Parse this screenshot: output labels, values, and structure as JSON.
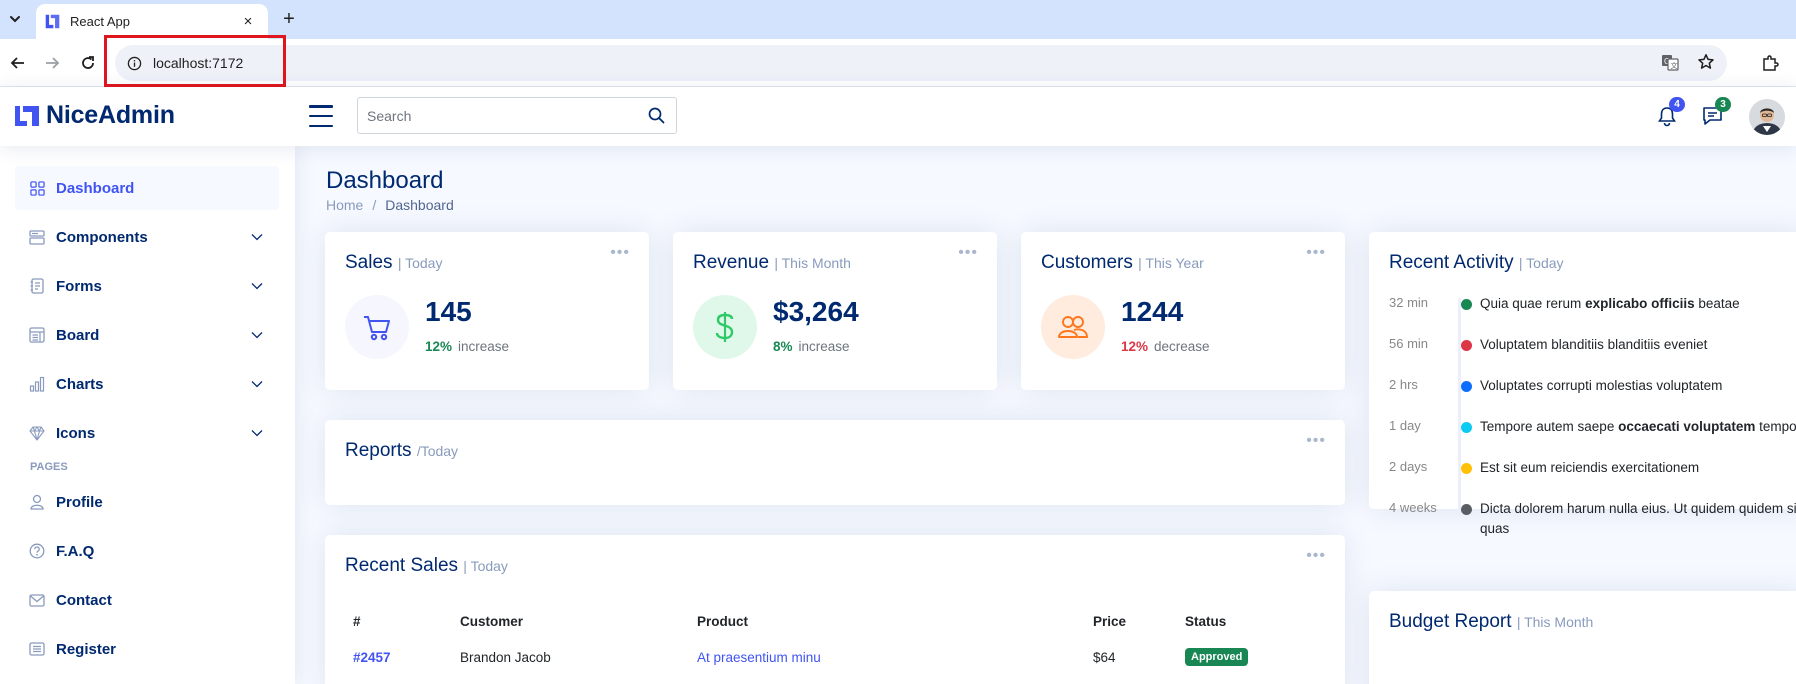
{
  "browser": {
    "tab_title": "React App",
    "url": "localhost:7172",
    "new_tab_symbol": "+",
    "close_symbol": "×"
  },
  "header": {
    "logo_text": "NiceAdmin",
    "search_placeholder": "Search",
    "notifications_count": "4",
    "messages_count": "3"
  },
  "sidebar": {
    "items": [
      {
        "label": "Dashboard",
        "icon": "grid-icon",
        "active": true,
        "has_chevron": false
      },
      {
        "label": "Components",
        "icon": "menu-button-icon",
        "has_chevron": true
      },
      {
        "label": "Forms",
        "icon": "journal-text-icon",
        "has_chevron": true
      },
      {
        "label": "Board",
        "icon": "layout-text-window-icon",
        "has_chevron": true
      },
      {
        "label": "Charts",
        "icon": "bar-chart-icon",
        "has_chevron": true
      },
      {
        "label": "Icons",
        "icon": "gem-icon",
        "has_chevron": true
      }
    ],
    "pages_heading": "Pages",
    "pages": [
      {
        "label": "Profile",
        "icon": "person-icon"
      },
      {
        "label": "F.A.Q",
        "icon": "question-circle-icon"
      },
      {
        "label": "Contact",
        "icon": "envelope-icon"
      },
      {
        "label": "Register",
        "icon": "card-list-icon"
      }
    ]
  },
  "page": {
    "title": "Dashboard",
    "breadcrumb": [
      "Home",
      "/",
      "Dashboard"
    ]
  },
  "cards": {
    "sales": {
      "title": "Sales",
      "period": "| Today",
      "value": "145",
      "pct": "12%",
      "word": "increase",
      "icon": "cart-icon"
    },
    "revenue": {
      "title": "Revenue",
      "period": "| This Month",
      "value": "$3,264",
      "pct": "8%",
      "word": "increase",
      "icon": "currency-dollar-icon"
    },
    "customers": {
      "title": "Customers",
      "period": "| This Year",
      "value": "1244",
      "pct": "12%",
      "word": "decrease",
      "icon": "people-icon"
    },
    "reports": {
      "title": "Reports",
      "period": "/Today"
    },
    "recent_sales": {
      "title": "Recent Sales",
      "period": "| Today"
    },
    "activity": {
      "title": "Recent Activity",
      "period": "| Today"
    },
    "budget": {
      "title": "Budget Report",
      "period": "| This Month"
    }
  },
  "activity": [
    {
      "time": "32 min",
      "color": "#198754",
      "pre": "Quia quae rerum ",
      "bold": "explicabo officiis",
      "post": " beatae"
    },
    {
      "time": "56 min",
      "color": "#dc3545",
      "pre": "Voluptatem blanditiis blanditiis eveniet",
      "bold": "",
      "post": ""
    },
    {
      "time": "2 hrs",
      "color": "#0d6efd",
      "pre": "Voluptates corrupti molestias voluptatem",
      "bold": "",
      "post": ""
    },
    {
      "time": "1 day",
      "color": "#0dcaf0",
      "pre": "Tempore autem saepe ",
      "bold": "occaecati voluptatem",
      "post": " tempore"
    },
    {
      "time": "2 days",
      "color": "#ffc107",
      "pre": "Est sit eum reiciendis exercitationem",
      "bold": "",
      "post": ""
    },
    {
      "time": "4 weeks",
      "color": "#595e64",
      "pre": "Dicta dolorem harum nulla eius. Ut quidem quidem sit quas",
      "bold": "",
      "post": ""
    }
  ],
  "recent_sales_table": {
    "headers": [
      "#",
      "Customer",
      "Product",
      "Price",
      "Status"
    ],
    "rows": [
      {
        "id": "#2457",
        "customer": "Brandon Jacob",
        "product": "At praesentium minu",
        "price": "$64",
        "status": "Approved"
      }
    ]
  },
  "colors": {
    "primary": "#4154f1",
    "navy": "#012970",
    "success": "#198754",
    "danger": "#dc3545",
    "muted": "#899bbd"
  }
}
